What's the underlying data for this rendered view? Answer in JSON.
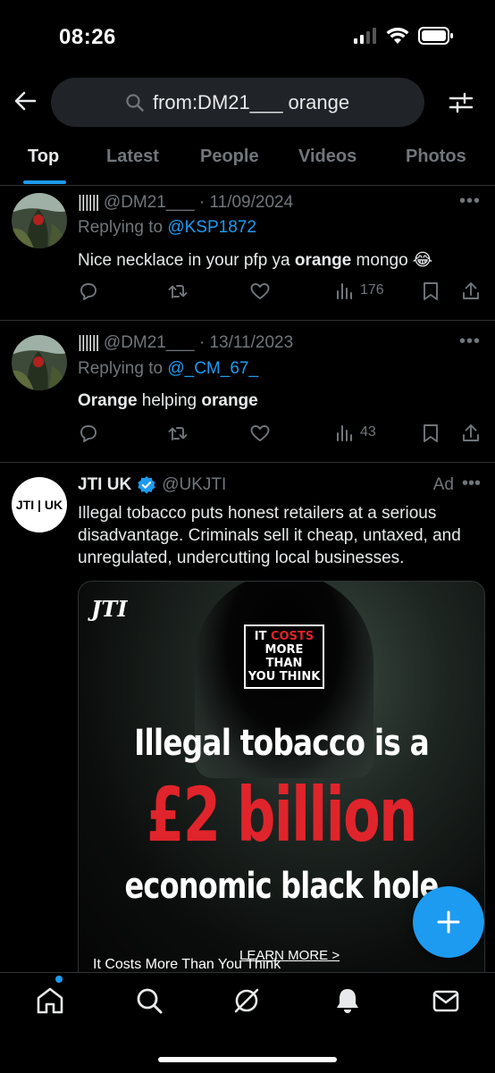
{
  "status": {
    "time": "08:26"
  },
  "search": {
    "query": "from:DM21___ orange"
  },
  "tabs": [
    {
      "label": "Top",
      "active": true
    },
    {
      "label": "Latest"
    },
    {
      "label": "People"
    },
    {
      "label": "Videos"
    },
    {
      "label": "Photos"
    }
  ],
  "tweets": [
    {
      "display_name": "||||||",
      "handle": "@DM21___",
      "date": "· 11/09/2024",
      "replying_prefix": "Replying to",
      "replying_to": "@KSP1872",
      "text_pre": "Nice necklace in your pfp ya ",
      "text_bold": "orange",
      "text_post": " mongo 😂",
      "views": "176"
    },
    {
      "display_name": "||||||",
      "handle": "@DM21___",
      "date": "· 13/11/2023",
      "replying_prefix": "Replying to",
      "replying_to": "@_CM_67_",
      "text_bold1": "Orange",
      "text_mid": " helping ",
      "text_bold2": "orange",
      "views": "43"
    }
  ],
  "ad": {
    "avatar_text": "JTI | UK",
    "name": "JTI UK",
    "handle": "@UKJTI",
    "label": "Ad",
    "body": "Illegal tobacco puts honest retailers at a serious disadvantage. Criminals sell it cheap, untaxed, and unregulated, undercutting local businesses.",
    "image": {
      "logo": "JTI",
      "badge_line1_a": "IT ",
      "badge_line1_b": "COSTS",
      "badge_line2": "MORE THAN",
      "badge_line3": "YOU THINK",
      "headline1": "Illegal tobacco is a",
      "headline2": "£2 billion",
      "headline3": "economic black hole",
      "caption": "It Costs More Than You Think",
      "learn_more": "LEARN MORE >"
    }
  },
  "colors": {
    "accent": "#1d9bf0",
    "muted": "#71767b",
    "ad_red": "#e0242b"
  }
}
